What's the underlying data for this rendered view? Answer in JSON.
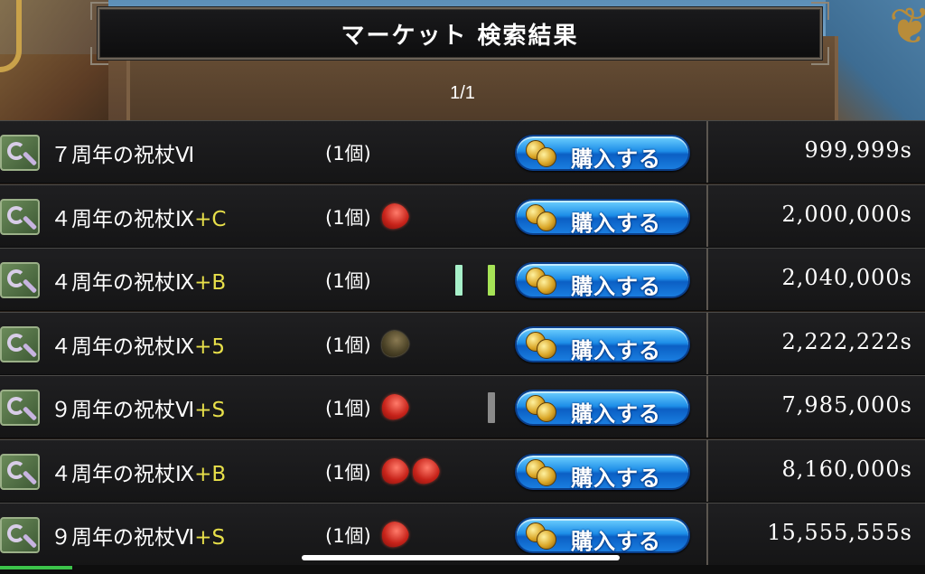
{
  "title": "マーケット 検索結果",
  "page_indicator": "1/1",
  "buy_label": "購入する",
  "colors": {
    "suffix": "#e8e04a",
    "button_top": "#6fd0ff",
    "button_bottom": "#0b5fc4",
    "tick_mint": "#a7f0c9",
    "tick_lime": "#a6e356",
    "tick_gray": "#8a8a8a"
  },
  "rows": [
    {
      "name": "７周年の祝杖Ⅵ",
      "suffix": "",
      "qty": "(1個)",
      "gems": [],
      "ticks": [],
      "price": "999,999s"
    },
    {
      "name": "４周年の祝杖Ⅸ",
      "suffix": "+C",
      "qty": "(1個)",
      "gems": [
        "red"
      ],
      "ticks": [],
      "price": "2,000,000s"
    },
    {
      "name": "４周年の祝杖Ⅸ",
      "suffix": "+B",
      "qty": "(1個)",
      "gems": [],
      "ticks": [
        "mint",
        "lime"
      ],
      "price": "2,040,000s"
    },
    {
      "name": "４周年の祝杖Ⅸ",
      "suffix": "+5",
      "qty": "(1個)",
      "gems": [
        "dark"
      ],
      "ticks": [],
      "price": "2,222,222s"
    },
    {
      "name": "９周年の祝杖Ⅵ",
      "suffix": "+S",
      "qty": "(1個)",
      "gems": [
        "red"
      ],
      "ticks": [
        "gray"
      ],
      "price": "7,985,000s"
    },
    {
      "name": "４周年の祝杖Ⅸ",
      "suffix": "+B",
      "qty": "(1個)",
      "gems": [
        "red",
        "red"
      ],
      "ticks": [],
      "price": "8,160,000s"
    },
    {
      "name": "９周年の祝杖Ⅵ",
      "suffix": "+S",
      "qty": "(1個)",
      "gems": [
        "red"
      ],
      "ticks": [],
      "price": "15,555,555s"
    }
  ]
}
